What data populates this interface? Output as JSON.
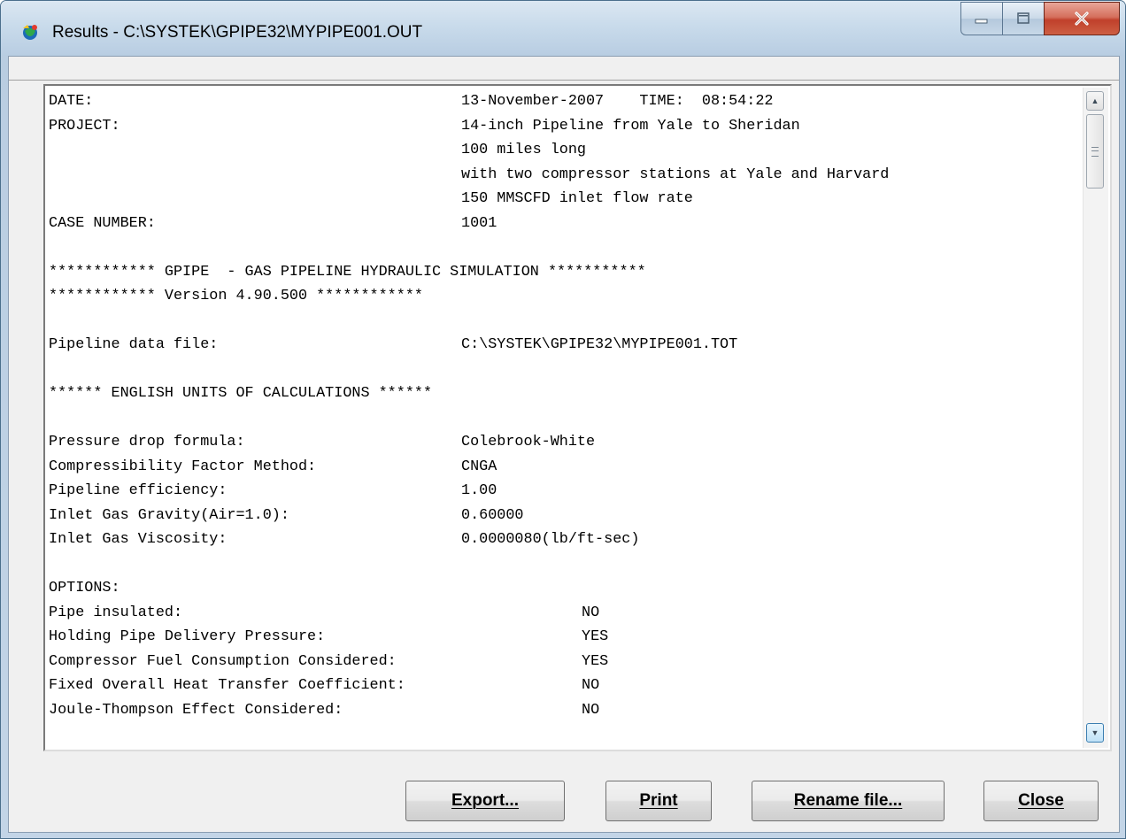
{
  "window": {
    "title": "Results -  C:\\SYSTEK\\GPIPE32\\MYPIPE001.OUT",
    "icon": "gpipe-app-icon"
  },
  "results": {
    "lines": [
      {
        "key": "DATE:",
        "value": "13-November-2007    TIME:  08:54:22",
        "col": "v"
      },
      {
        "key": "PROJECT:",
        "value": "14-inch Pipeline from Yale to Sheridan",
        "col": "v"
      },
      {
        "key": "",
        "value": "100 miles long",
        "col": "v"
      },
      {
        "key": "",
        "value": "with two compressor stations at Yale and Harvard",
        "col": "v"
      },
      {
        "key": "",
        "value": "150 MMSCFD inlet flow rate",
        "col": "v"
      },
      {
        "key": "CASE NUMBER:",
        "value": "1001",
        "col": "v"
      },
      {
        "key": "",
        "value": "",
        "col": "v"
      },
      {
        "key": "************ GPIPE  - GAS PIPELINE HYDRAULIC SIMULATION ***********",
        "value": "",
        "col": "v"
      },
      {
        "key": "************ Version 4.90.500 ************",
        "value": "",
        "col": "v"
      },
      {
        "key": "",
        "value": "",
        "col": "v"
      },
      {
        "key": "Pipeline data file:",
        "value": "C:\\SYSTEK\\GPIPE32\\MYPIPE001.TOT",
        "col": "v"
      },
      {
        "key": "",
        "value": "",
        "col": "v"
      },
      {
        "key": "****** ENGLISH UNITS OF CALCULATIONS ******",
        "value": "",
        "col": "v"
      },
      {
        "key": "",
        "value": "",
        "col": "v"
      },
      {
        "key": "Pressure drop formula:",
        "value": "Colebrook-White",
        "col": "v"
      },
      {
        "key": "Compressibility Factor Method:",
        "value": "CNGA",
        "col": "v"
      },
      {
        "key": "Pipeline efficiency:",
        "value": "1.00",
        "col": "v"
      },
      {
        "key": "Inlet Gas Gravity(Air=1.0):",
        "value": "0.60000",
        "col": "v"
      },
      {
        "key": "Inlet Gas Viscosity:",
        "value": "0.0000080(lb/ft-sec)",
        "col": "v"
      },
      {
        "key": "",
        "value": "",
        "col": "v"
      },
      {
        "key": "OPTIONS:",
        "value": "",
        "col": "v"
      },
      {
        "key": "Pipe insulated:",
        "value": "NO",
        "col": "v2"
      },
      {
        "key": "Holding Pipe Delivery Pressure:",
        "value": "YES",
        "col": "v2"
      },
      {
        "key": "Compressor Fuel Consumption Considered:",
        "value": "YES",
        "col": "v2"
      },
      {
        "key": "Fixed Overall Heat Transfer Coefficient:",
        "value": "NO",
        "col": "v2"
      },
      {
        "key": "Joule-Thompson Effect Considered:",
        "value": "NO",
        "col": "v2"
      }
    ]
  },
  "buttons": {
    "export": "Export...",
    "print": "Print",
    "rename": "Rename file...",
    "close": "Close"
  },
  "colors": {
    "close_button": "#c7412c",
    "window_frame": "#c3d5e7"
  }
}
